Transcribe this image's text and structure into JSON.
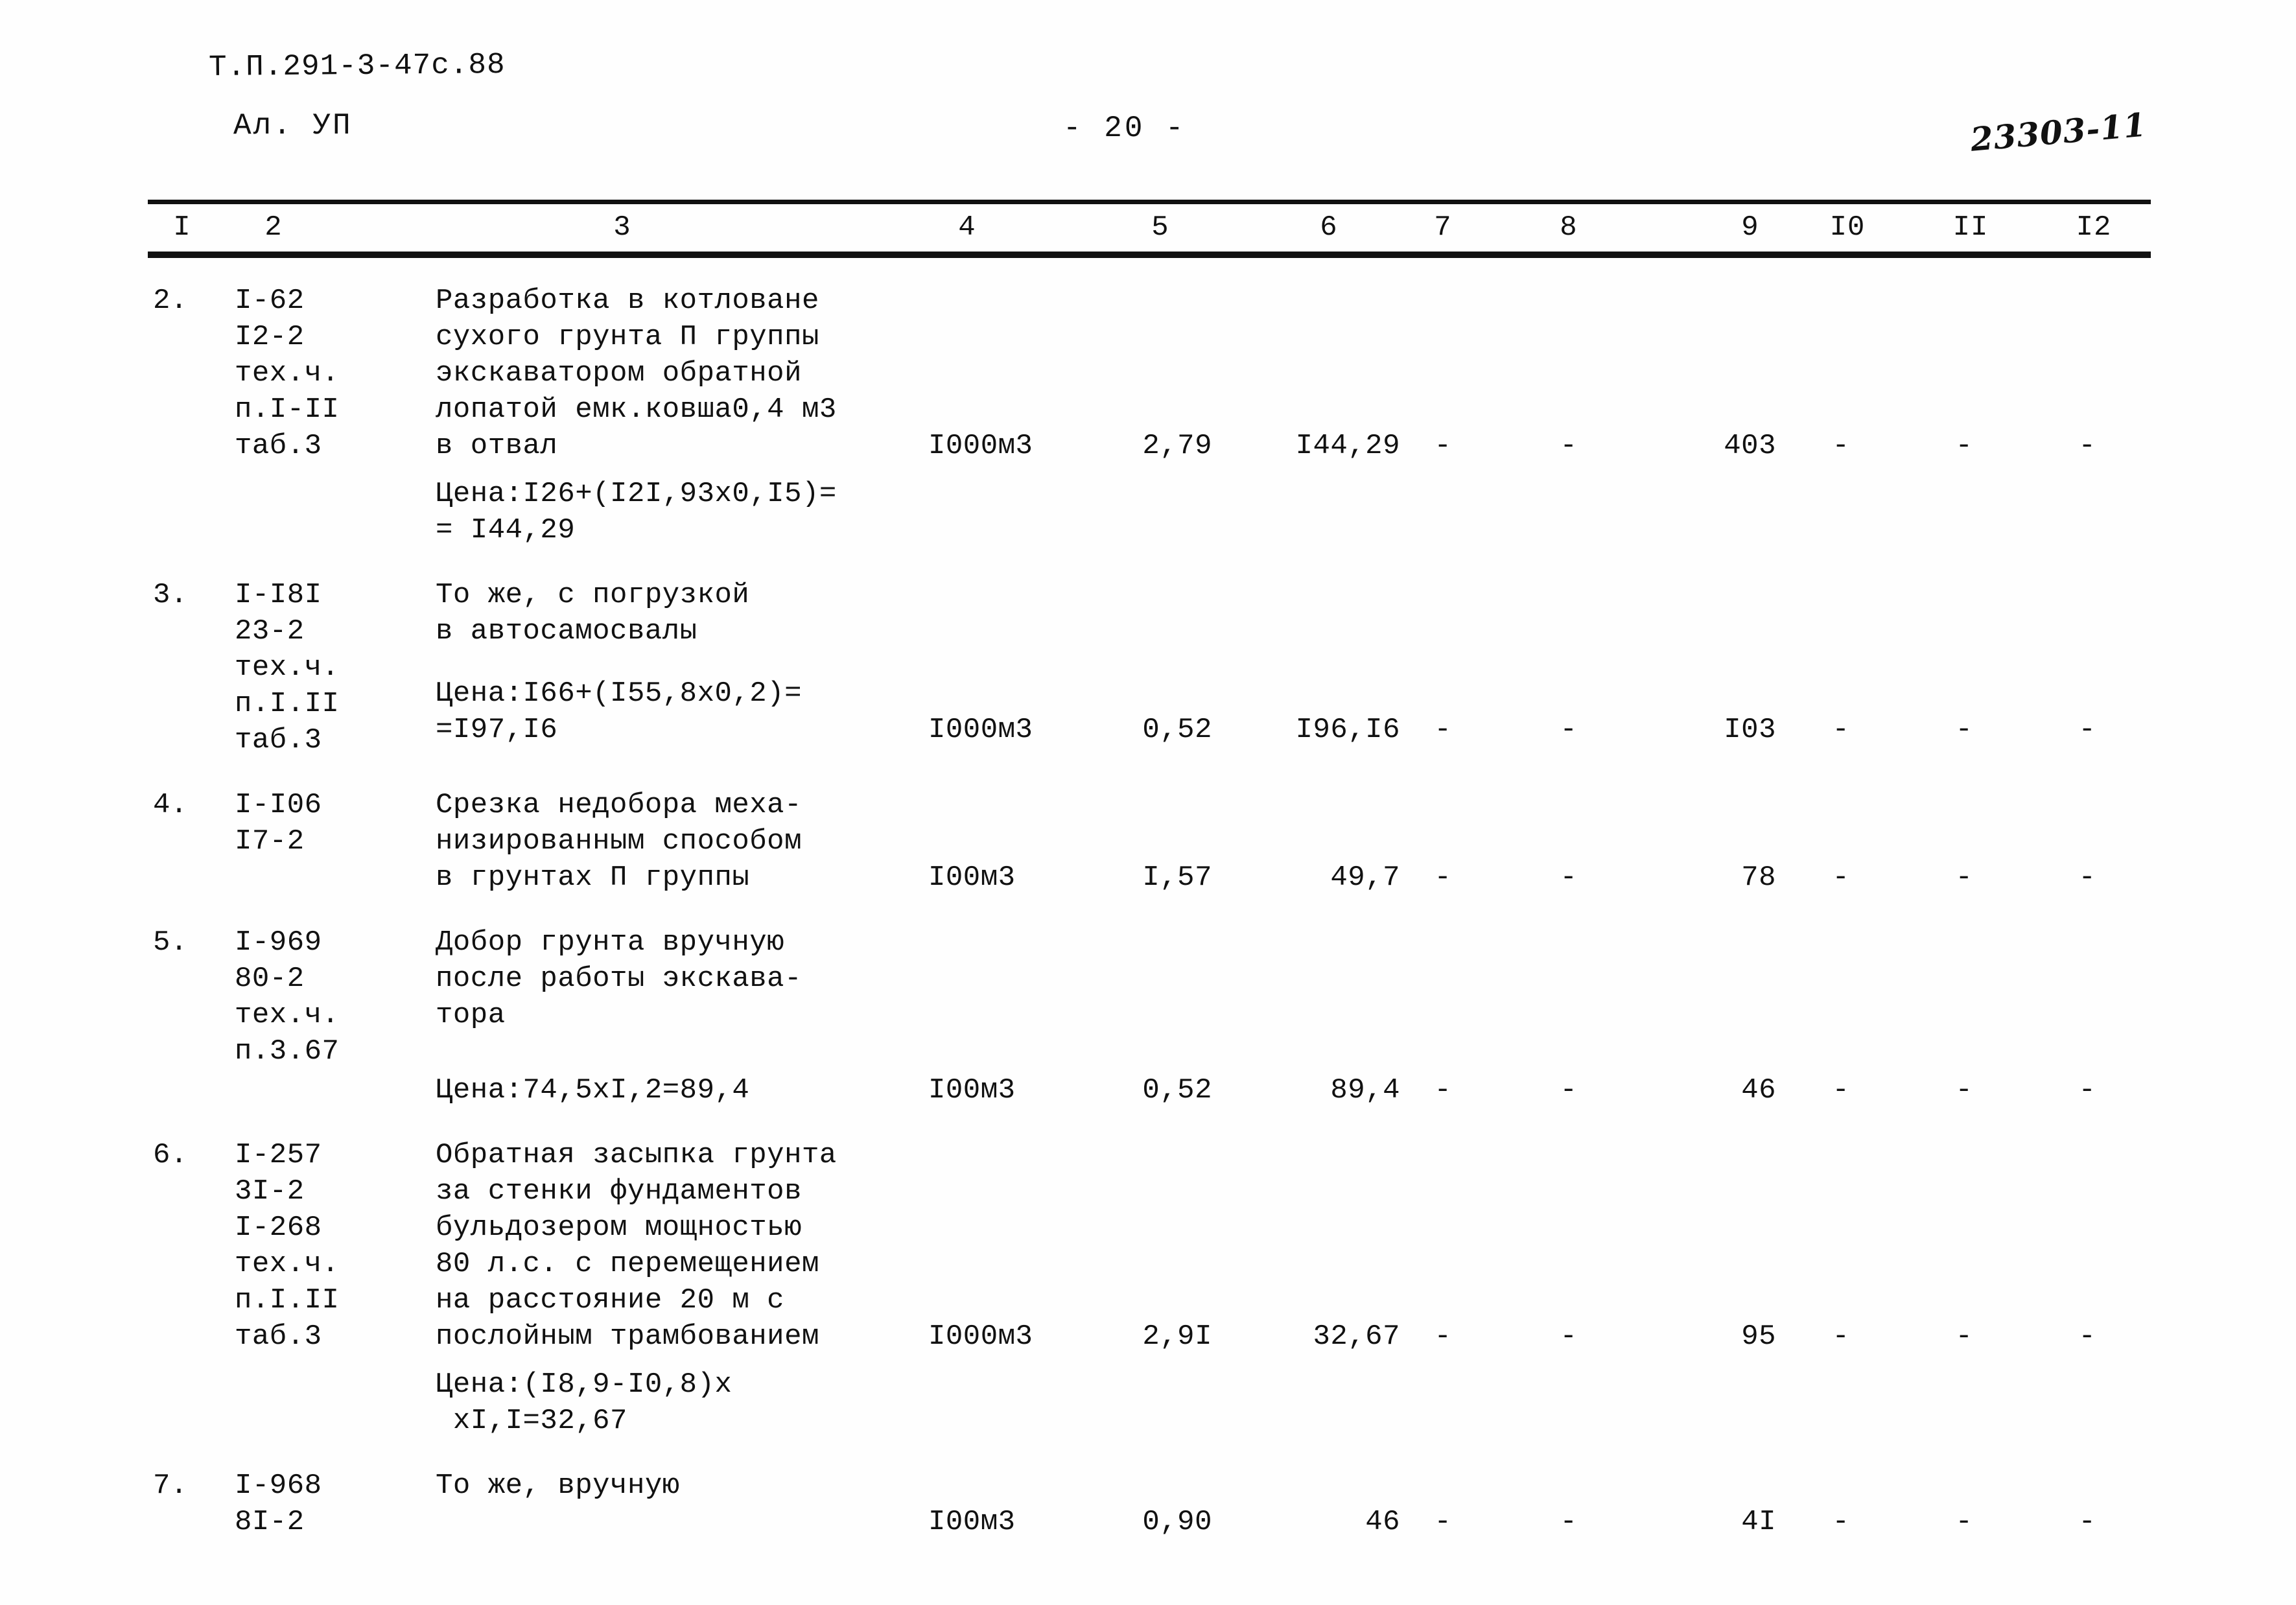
{
  "header": {
    "doc_code": "Т.П.291-3-47с.88",
    "album": "Ал. УП",
    "page_number": "- 20 -",
    "archive_mark": "23303-11"
  },
  "table": {
    "column_headers": [
      "I",
      "2",
      "3",
      "4",
      "5",
      "6",
      "7",
      "8",
      "9",
      "I0",
      "II",
      "I2"
    ],
    "rows": [
      {
        "no": "2.",
        "code_lines": [
          "I-62",
          "I2-2",
          "тех.ч.",
          "п.I-II",
          "таб.3"
        ],
        "desc_lines": [
          "Разработка в котловане",
          "сухого грунта П группы",
          "экскаватором обратной",
          "лопатой емк.ковша0,4 м3",
          "в отвал"
        ],
        "unit": "I000м3",
        "qty": "2,79",
        "price": "I44,29",
        "c7": "-",
        "c8": "-",
        "c9": "403",
        "c10": "-",
        "c11": "-",
        "c12": "-",
        "note_lines": [
          "Цена:I26+(I2I,93x0,I5)=",
          "= I44,29"
        ]
      },
      {
        "no": "3.",
        "code_lines": [
          "I-I8I",
          "23-2",
          "тех.ч.",
          "п.I.II",
          "таб.3"
        ],
        "desc_lines": [
          "То же, с погрузкой",
          "в автосамосвалы"
        ],
        "unit": "I000м3",
        "qty": "0,52",
        "price": "I96,I6",
        "c7": "-",
        "c8": "-",
        "c9": "I03",
        "c10": "-",
        "c11": "-",
        "c12": "-",
        "note_lines": [
          "Цена:I66+(I55,8x0,2)=",
          "=I97,I6"
        ]
      },
      {
        "no": "4.",
        "code_lines": [
          "I-I06",
          "I7-2"
        ],
        "desc_lines": [
          "Срезка недобора меха-",
          "низированным способом",
          "в грунтах П группы"
        ],
        "unit": "I00м3",
        "qty": "I,57",
        "price": "49,7",
        "c7": "-",
        "c8": "-",
        "c9": "78",
        "c10": "-",
        "c11": "-",
        "c12": "-",
        "note_lines": []
      },
      {
        "no": "5.",
        "code_lines": [
          "I-969",
          "80-2",
          "тех.ч.",
          "п.3.67"
        ],
        "desc_lines": [
          "Добор грунта вручную",
          "после работы экскава-",
          "тора"
        ],
        "unit": "I00м3",
        "qty": "0,52",
        "price": "89,4",
        "c7": "-",
        "c8": "-",
        "c9": "46",
        "c10": "-",
        "c11": "-",
        "c12": "-",
        "note_lines": [
          "Цена:74,5xI,2=89,4"
        ]
      },
      {
        "no": "6.",
        "code_lines": [
          "I-257",
          "3I-2",
          "I-268",
          "тех.ч.",
          "п.I.II",
          "таб.3"
        ],
        "desc_lines": [
          "Обратная засыпка грунта",
          "за стенки фундаментов",
          "бульдозером мощностью",
          "80 л.с. с перемещением",
          "на расстояние 20 м с",
          "послойным трамбованием"
        ],
        "unit": "I000м3",
        "qty": "2,9I",
        "price": "32,67",
        "c7": "-",
        "c8": "-",
        "c9": "95",
        "c10": "-",
        "c11": "-",
        "c12": "-",
        "note_lines": [
          "Цена:(I8,9-I0,8)x",
          " xI,I=32,67"
        ]
      },
      {
        "no": "7.",
        "code_lines": [
          "I-968",
          "8I-2"
        ],
        "desc_lines": [
          "То же, вручную"
        ],
        "unit": "I00м3",
        "qty": "0,90",
        "price": "46",
        "c7": "-",
        "c8": "-",
        "c9": "4I",
        "c10": "-",
        "c11": "-",
        "c12": "-",
        "note_lines": []
      }
    ]
  }
}
